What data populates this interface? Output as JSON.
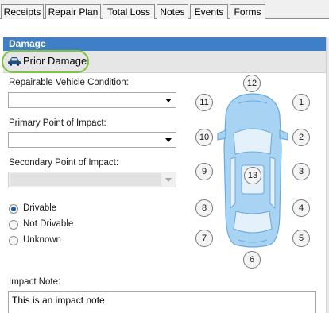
{
  "tabs": [
    "Receipts",
    "Repair Plan",
    "Total Loss",
    "Notes",
    "Events",
    "Forms"
  ],
  "section_title": "Damage",
  "subsection_title": "Prior Damage",
  "fields": {
    "repairable_label": "Repairable Vehicle Condition:",
    "repairable_value": "",
    "primary_label": "Primary Point of Impact:",
    "primary_value": "",
    "secondary_label": "Secondary Point of Impact:",
    "secondary_value": ""
  },
  "drivable": {
    "options": [
      "Drivable",
      "Not Drivable",
      "Unknown"
    ],
    "selected": "Drivable"
  },
  "points_of_impact": [
    "1",
    "2",
    "3",
    "4",
    "5",
    "6",
    "7",
    "8",
    "9",
    "10",
    "11",
    "12",
    "13"
  ],
  "impact_note": {
    "label": "Impact Note:",
    "value": "This is an impact note"
  },
  "colors": {
    "header_blue": "#3f7fc7",
    "highlight_green": "#7ec242",
    "car_blue": "#9fcdf2"
  },
  "icons": {
    "subsection": "car-icon"
  }
}
